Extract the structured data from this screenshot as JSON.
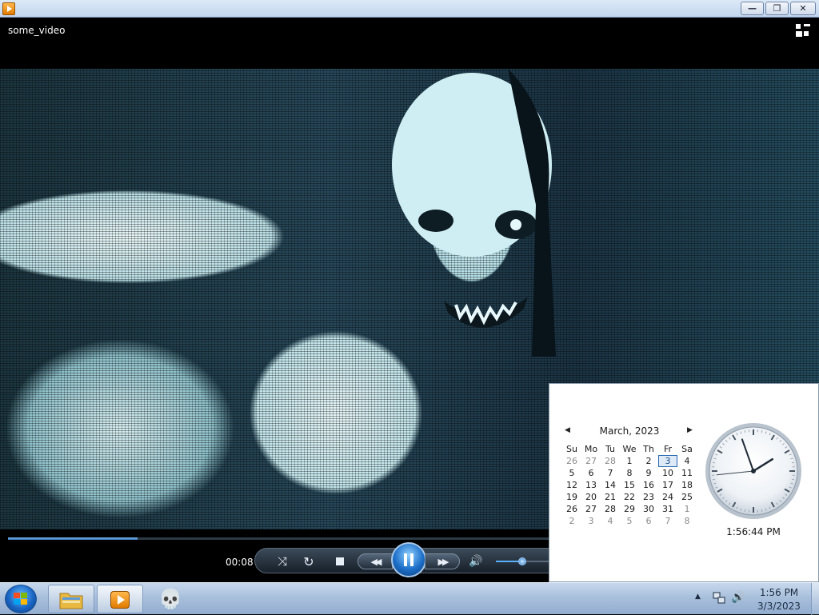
{
  "window": {
    "video_title": "some_video",
    "caption_buttons": {
      "minimize": "—",
      "maximize": "❐",
      "close": "✕"
    }
  },
  "player": {
    "elapsed": "00:08",
    "progress_fraction": 0.24,
    "volume_fraction": 0.5,
    "state": "playing"
  },
  "flyout": {
    "month_label": "March, 2023",
    "weekdays": [
      "Su",
      "Mo",
      "Tu",
      "We",
      "Th",
      "Fr",
      "Sa"
    ],
    "weeks": [
      [
        "26",
        "27",
        "28",
        "1",
        "2",
        "3",
        "4"
      ],
      [
        "5",
        "6",
        "7",
        "8",
        "9",
        "10",
        "11"
      ],
      [
        "12",
        "13",
        "14",
        "15",
        "16",
        "17",
        "18"
      ],
      [
        "19",
        "20",
        "21",
        "22",
        "23",
        "24",
        "25"
      ],
      [
        "26",
        "27",
        "28",
        "29",
        "30",
        "31",
        "1"
      ],
      [
        "2",
        "3",
        "4",
        "5",
        "6",
        "7",
        "8"
      ]
    ],
    "today": "3",
    "clock_time": "1:56:44 PM",
    "clock_hands": {
      "hour": 1,
      "minute": 56,
      "second": 44
    }
  },
  "taskbar": {
    "time": "1:56 PM",
    "date": "3/3/2023",
    "pinned": [
      "folder-icon",
      "media-player-icon",
      "skull-icon"
    ]
  },
  "colors": {
    "accent": "#1d6fc9",
    "today_border": "#2a69b3",
    "taskbar": "#a9c0dc"
  }
}
